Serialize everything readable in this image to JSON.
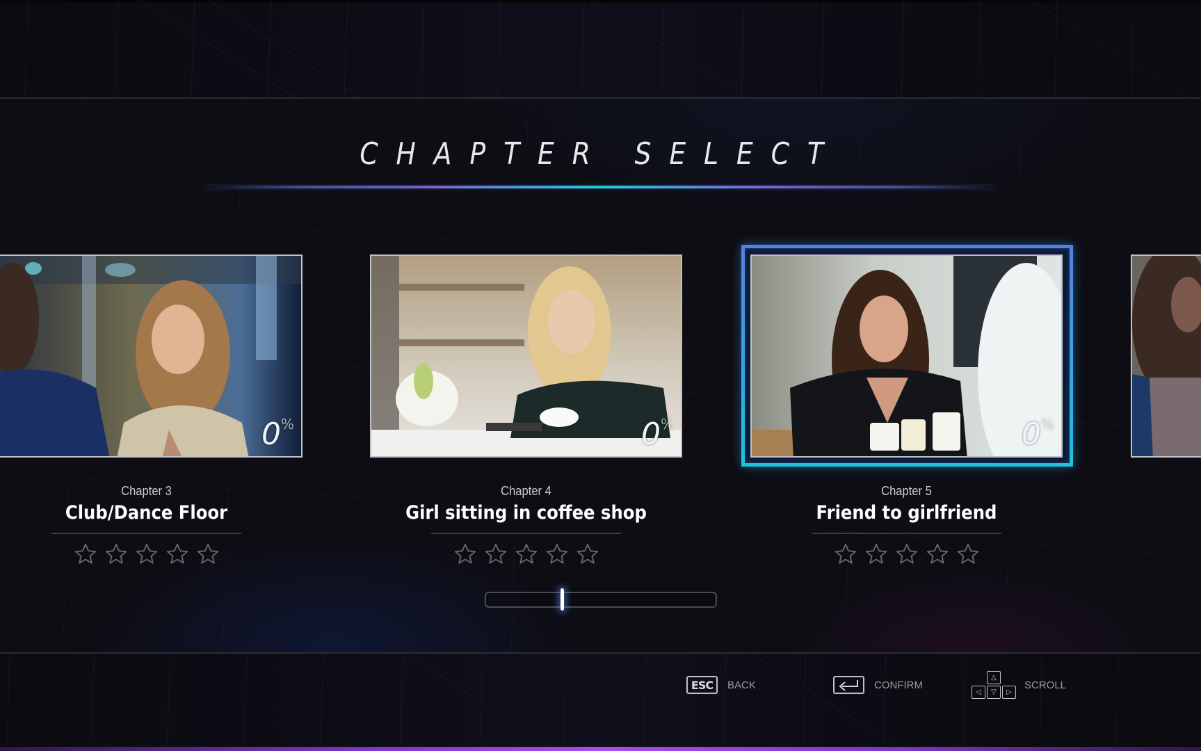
{
  "screen": {
    "title": "CHAPTER SELECT"
  },
  "colors": {
    "accent_cyan": "#1fcfdc",
    "accent_purple": "#7a66d6",
    "selection_top": "#5a7de2",
    "selection_bottom": "#1fc2dc",
    "bottom_bar": "#a84cf0",
    "background": "#0d0d13"
  },
  "chapters": [
    {
      "number_label": "Chapter 3",
      "title": "Club/Dance Floor",
      "progress_value": "0",
      "progress_sign": "%",
      "progress_fraction": 0,
      "rating": 0,
      "rating_max": 5,
      "selected": false,
      "scene": "club-dance-floor"
    },
    {
      "number_label": "Chapter 4",
      "title": "Girl sitting in coffee shop",
      "progress_value": "0",
      "progress_sign": "%",
      "progress_fraction": 0,
      "rating": 0,
      "rating_max": 5,
      "selected": false,
      "scene": "coffee-shop"
    },
    {
      "number_label": "Chapter 5",
      "title": "Friend to girlfriend",
      "progress_value": "0",
      "progress_sign": "%",
      "progress_fraction": 0,
      "rating": 0,
      "rating_max": 5,
      "selected": true,
      "scene": "cafe-smiling"
    },
    {
      "number_label": "",
      "title": "",
      "selected": false,
      "partial": true,
      "scene": "bearded-man"
    }
  ],
  "scrollbar": {
    "position_fraction": 0.33
  },
  "footer": {
    "back": {
      "key": "ESC",
      "label": "BACK",
      "icon": "esc-key-icon"
    },
    "confirm": {
      "key": "enter",
      "label": "CONFIRM",
      "icon": "enter-key-icon"
    },
    "scroll": {
      "key": "arrows",
      "label": "SCROLL",
      "icon": "arrow-keys-icon"
    }
  }
}
